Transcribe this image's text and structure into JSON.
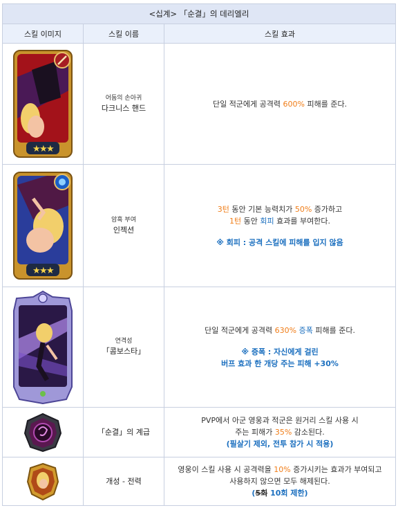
{
  "title": "<십계> 「순결」의 데리엘리",
  "headers": {
    "image": "스킬 이미지",
    "name": "스킬 이름",
    "effect": "스킬 효과"
  },
  "rows": [
    {
      "icon": "dark-fist-skill-card-icon",
      "sub": "어둠의 손아귀",
      "name": "다크니스 핸드",
      "effect": {
        "a": "단일 적군에게 공격력 ",
        "b": "600%",
        "c": " 피해를 준다."
      }
    },
    {
      "icon": "injection-skill-card-icon",
      "sub": "암흑 부여",
      "name": "인젝션",
      "effect": {
        "l1a": "3턴",
        "l1b": " 동안 기본 능력치가 ",
        "l1c": "50%",
        "l1d": " 증가하고",
        "l2a": "1턴",
        "l2b": " 동안 ",
        "l2c": "회피",
        "l2d": " 효과를 부여한다.",
        "note": "※ 회피 : 공격 스킬에 피해를 입지 않음"
      }
    },
    {
      "icon": "combo-star-ultimate-card-icon",
      "sub": "연격성",
      "name": "「콤보스타」",
      "effect": {
        "l1a": "단일 적군에게 공격력 ",
        "l1b": "630%",
        "l1c": " ",
        "l1d": "증폭",
        "l1e": " 피해를 준다.",
        "n1": "※ 증폭 : 자신에게 걸린",
        "n2": "버프 효과 한 개당 주는 피해 +30%"
      }
    },
    {
      "icon": "purity-hierarchy-passive-icon",
      "name": "「순결」의 계급",
      "effect": {
        "l1": "PVP에서 아군 영웅과 적군은 원거리 스킬 사용 시",
        "l2a": "주는 피해가 ",
        "l2b": "35%",
        "l2c": " 감소된다.",
        "l3": "(필살기 제외, 전투 참가 시 적용)"
      }
    },
    {
      "icon": "trait-combat-power-icon",
      "name": "개성 - 전력",
      "effect": {
        "l1a": "영웅이 스킬 사용 시 공격력을 ",
        "l1b": "10%",
        "l1c": " 증가시키는 효과가 부여되고",
        "l2": "사용하지 않으면 모두 해제된다.",
        "l3a": "(",
        "l3b": "5회",
        "l3c": " 10회 제한)"
      }
    }
  ],
  "colors": {
    "accent_orange": "#f07d18",
    "accent_blue": "#1b6fbf",
    "header_bg": "#dfe6f5",
    "grid": "#c7cfe0"
  }
}
